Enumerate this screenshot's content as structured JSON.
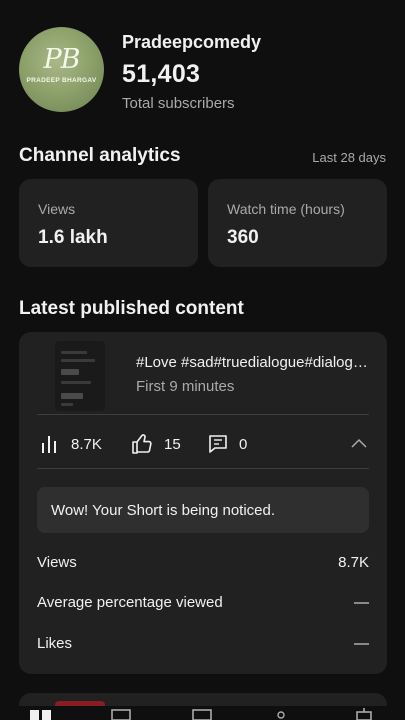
{
  "channel": {
    "name": "Pradeepcomedy",
    "subscribers": "51,403",
    "subscribers_label": "Total subscribers",
    "avatar_monogram": "PB",
    "avatar_text": "PRADEEP BHARGAV"
  },
  "analytics": {
    "title": "Channel analytics",
    "period": "Last 28 days",
    "stats": [
      {
        "label": "Views",
        "value": "1.6 lakh"
      },
      {
        "label": "Watch time (hours)",
        "value": "360"
      }
    ]
  },
  "latest": {
    "title": "Latest published content",
    "video": {
      "title": "#Love #sad#truedialogue#dialogue",
      "subtitle": "First 9 minutes",
      "views": "8.7K",
      "likes": "15",
      "comments": "0"
    },
    "notice": "Wow! Your Short is being noticed.",
    "rows": [
      {
        "label": "Views",
        "value": "8.7K"
      },
      {
        "label": "Average percentage viewed",
        "value": "—"
      },
      {
        "label": "Likes",
        "value": "—"
      }
    ]
  },
  "icons": {
    "views": "bar-chart-icon",
    "likes": "thumbs-up-icon",
    "comments": "comment-icon",
    "collapse": "chevron-up-icon"
  },
  "colors": {
    "background": "#0f0f0f",
    "card": "#212121",
    "notice": "#2f2f2f",
    "secondary_text": "#aaaaaa"
  }
}
